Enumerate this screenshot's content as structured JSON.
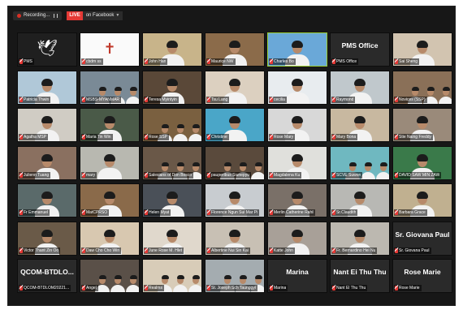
{
  "topbar": {
    "recording_label": "Recording...",
    "live_label": "LIVE",
    "live_target": "on Facebook"
  },
  "colors": {
    "recording": "#d93025",
    "live": "#e53935",
    "mic_muted": "#e53935",
    "speaker_border": "#9acd32"
  },
  "participants": [
    {
      "name": "PMS",
      "bg": "#1f1f1f",
      "style": "logo-dove"
    },
    {
      "name": "cbdm ss",
      "bg": "#fafafa",
      "style": "logo-cross"
    },
    {
      "name": "John Han",
      "bg": "#c8b48a",
      "style": "person"
    },
    {
      "name": "Maurice NW",
      "bg": "#8b6b4a",
      "style": "person"
    },
    {
      "name": "Charles Bo",
      "bg": "#6aa8d8",
      "style": "person",
      "active": true
    },
    {
      "name": "PMS Office",
      "center": "PMS Office",
      "style": "text"
    },
    {
      "name": "Sai Sheng",
      "bg": "#d2c4b0",
      "style": "person"
    },
    {
      "name": "Patricia Thwin",
      "bg": "#b0c8d8",
      "style": "person"
    },
    {
      "name": "MSBS-MYANMAR",
      "bg": "#7a8a96",
      "style": "group"
    },
    {
      "name": "Teresa Myintyin",
      "bg": "#5a4838",
      "style": "person"
    },
    {
      "name": "Tsu Lang",
      "bg": "#dcd0c0",
      "style": "person"
    },
    {
      "name": "cecilia",
      "bg": "#e8ecef",
      "style": "person"
    },
    {
      "name": "Raymond",
      "bg": "#c0c8cc",
      "style": "person"
    },
    {
      "name": "Novices (SSP)",
      "bg": "#8a7058",
      "style": "group"
    },
    {
      "name": "Agatha MSP",
      "bg": "#d0ccc4",
      "style": "person"
    },
    {
      "name": "Maria Tin Win",
      "bg": "#4a5a48",
      "style": "person"
    },
    {
      "name": "Rose SSP",
      "bg": "#7a6040",
      "style": "group"
    },
    {
      "name": "Christine",
      "bg": "#4aa6c8",
      "style": "person"
    },
    {
      "name": "Rose Mary",
      "bg": "#d8d8d8",
      "style": "person"
    },
    {
      "name": "Mary Bona",
      "bg": "#c8b8a0",
      "style": "person"
    },
    {
      "name": "Stie Naing Freddy",
      "bg": "#9a8a7a",
      "style": "person"
    },
    {
      "name": "Julienn Tuang",
      "bg": "#8a7060",
      "style": "person"
    },
    {
      "name": "mary",
      "bg": "#b8b8b0",
      "style": "person"
    },
    {
      "name": "Salesians of Don Bosco",
      "bg": "#6a5848",
      "style": "group"
    },
    {
      "name": "pauperibus Siunepyu",
      "bg": "#5a4a3c",
      "style": "group"
    },
    {
      "name": "Magdalena Ku",
      "bg": "#e0e0dc",
      "style": "person"
    },
    {
      "name": "SCVE Suwon",
      "bg": "#6fb8c0",
      "style": "group"
    },
    {
      "name": "DAVID SAW MIN ZAW",
      "bg": "#3a7a4a",
      "style": "person"
    },
    {
      "name": "Fr Emmanuel",
      "bg": "#5a6a6a",
      "style": "person"
    },
    {
      "name": "MatCPRSO",
      "bg": "#8a6a4a",
      "style": "person"
    },
    {
      "name": "Helen Myat",
      "bg": "#4a5058",
      "style": "person"
    },
    {
      "name": "Florence Ngun Sui Mar Pi",
      "bg": "#c8ccd0",
      "style": "person"
    },
    {
      "name": "Merlin Catherine Rahil",
      "bg": "#7a7068",
      "style": "person"
    },
    {
      "name": "Sr.Claudith",
      "bg": "#b8b8b4",
      "style": "person"
    },
    {
      "name": "Barbara Grace",
      "bg": "#c0b090",
      "style": "person"
    },
    {
      "name": "Victor Thant Zin Oo",
      "bg": "#6a5a48",
      "style": "person"
    },
    {
      "name": "Daw Cho Cho Win",
      "bg": "#d8c8b0",
      "style": "person"
    },
    {
      "name": "June Rose M. Hlet",
      "bg": "#e0d8cc",
      "style": "person"
    },
    {
      "name": "Albertine Nui Sin Kai",
      "bg": "#c8c0b4",
      "style": "person"
    },
    {
      "name": "Katte John",
      "bg": "#a8a098",
      "style": "person"
    },
    {
      "name": "Fr. Bernardino Hei Nu",
      "bg": "#bcb8b0",
      "style": "person"
    },
    {
      "name": "Sr. Giovana Paul",
      "center": "Sr. Giovana Paul",
      "style": "text"
    },
    {
      "name": "QCOM-BTDLOM20221...",
      "center": "QCOM-BTDLO...",
      "style": "text"
    },
    {
      "name": "Angel",
      "bg": "#5a5048",
      "style": "group"
    },
    {
      "name": "Realms",
      "bg": "#d8ccb8",
      "style": "group"
    },
    {
      "name": "St. Joseph Sch Taunggyi",
      "bg": "#a4acb0",
      "style": "group"
    },
    {
      "name": "Marina",
      "center": "Marina",
      "style": "text"
    },
    {
      "name": "Nant El Thu Thu",
      "center": "Nant Ei Thu Thu",
      "style": "text"
    },
    {
      "name": "Rose Marie",
      "center": "Rose Marie",
      "style": "text"
    }
  ]
}
